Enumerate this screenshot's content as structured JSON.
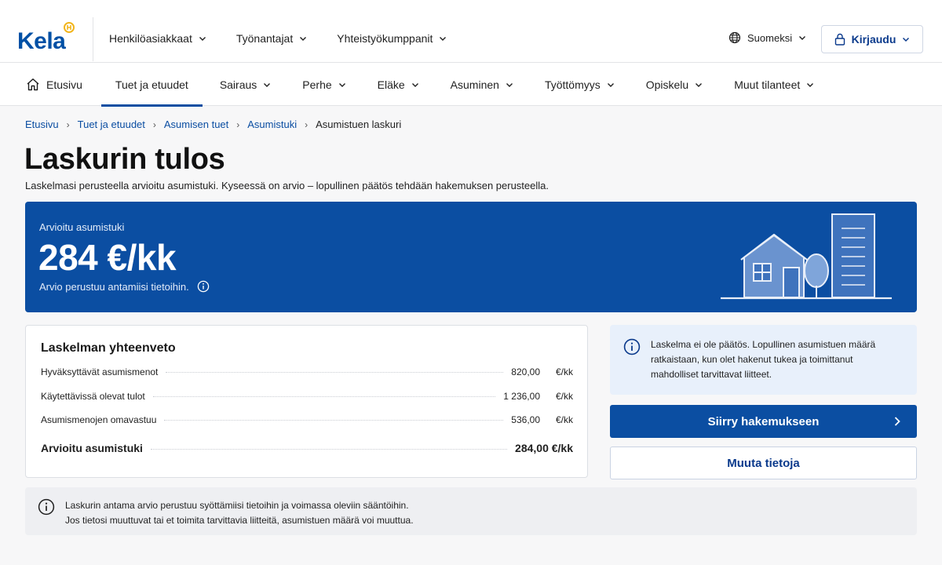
{
  "brand": {
    "name": "Kela"
  },
  "topnav": {
    "items": [
      {
        "label": "Henkilöasiakkaat"
      },
      {
        "label": "Työnantajat"
      },
      {
        "label": "Yhteistyökumppanit"
      }
    ],
    "language": "Suomeksi",
    "login": "Kirjaudu"
  },
  "secnav": {
    "home": "Etusivu",
    "items": [
      {
        "label": "Tuet ja etuudet"
      },
      {
        "label": "Sairaus"
      },
      {
        "label": "Perhe"
      },
      {
        "label": "Eläke"
      },
      {
        "label": "Asuminen"
      },
      {
        "label": "Työttömyys"
      },
      {
        "label": "Opiskelu"
      },
      {
        "label": "Muut tilanteet"
      }
    ]
  },
  "breadcrumb": {
    "items": [
      "Etusivu",
      "Tuet ja etuudet",
      "Asumisen tuet",
      "Asumistuki"
    ],
    "current": "Asumistuen laskuri"
  },
  "page": {
    "title": "Laskurin tulos",
    "lead": "Laskelmasi perusteella arvioitu asumistuki. Kyseessä on arvio – lopullinen päätös tehdään hakemuksen perusteella."
  },
  "result": {
    "label": "Arvioitu asumistuki",
    "amount": "284 €/kk",
    "note": "Arvio perustuu antamiisi tietoihin."
  },
  "summary": {
    "title": "Laskelman yhteenveto",
    "rows": [
      {
        "label": "Hyväksyttävät asumismenot",
        "value": "820,00",
        "unit": "€/kk"
      },
      {
        "label": "Käytettävissä olevat tulot",
        "value": "1 236,00",
        "unit": "€/kk"
      },
      {
        "label": "Asumismenojen omavastuu",
        "value": "536,00",
        "unit": "€/kk"
      }
    ],
    "total": {
      "label": "Arvioitu asumistuki",
      "value": "284,00 €/kk"
    }
  },
  "info": {
    "text": "Laskelma ei ole päätös. Lopullinen asumistuen määrä ratkaistaan, kun olet hakenut tukea ja toimittanut mahdolliset tarvittavat liitteet."
  },
  "actions": {
    "primary": "Siirry hakemukseen",
    "secondary": "Muuta tietoja"
  },
  "footnote": {
    "line1": "Laskurin antama arvio perustuu syöttämiisi tietoihin ja voimassa oleviin sääntöihin.",
    "line2": "Jos tietosi muuttuvat tai et toimita tarvittavia liitteitä, asumistuen määrä voi muuttua."
  },
  "colors": {
    "brand": "#0b4ea2",
    "logo_mark": "#f2b51c",
    "info_bg": "#e8f0fb"
  }
}
